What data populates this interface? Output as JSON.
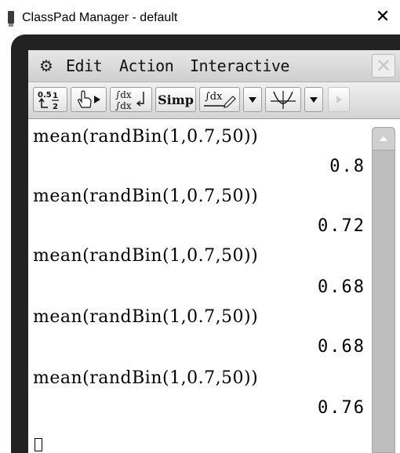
{
  "window": {
    "title": "ClassPad Manager - default",
    "close_symbol": "✕"
  },
  "menubar": {
    "gear_icon": "gear-icon",
    "items": [
      "Edit",
      "Action",
      "Interactive"
    ],
    "close_symbol": "✕"
  },
  "toolbar": {
    "buttons": [
      {
        "name": "decimal-fraction-toggle-icon"
      },
      {
        "name": "hand-drag-icon"
      },
      {
        "name": "integral-compare-icon"
      },
      {
        "name": "simp-button",
        "label": "Simp"
      },
      {
        "name": "integral-pen-icon"
      },
      {
        "name": "dropdown-arrow-icon"
      },
      {
        "name": "graph-icon"
      },
      {
        "name": "dropdown-arrow-icon"
      },
      {
        "name": "toolbar-scroll-right-icon"
      }
    ]
  },
  "work": {
    "entries": [
      {
        "input": "mean(randBin(1,0.7,50))",
        "output": "0.8"
      },
      {
        "input": "mean(randBin(1,0.7,50))",
        "output": "0.72"
      },
      {
        "input": "mean(randBin(1,0.7,50))",
        "output": "0.68"
      },
      {
        "input": "mean(randBin(1,0.7,50))",
        "output": "0.68"
      },
      {
        "input": "mean(randBin(1,0.7,50))",
        "output": "0.76"
      }
    ]
  },
  "colors": {
    "device_frame": "#222222",
    "scrollbar": "#bdbdbd"
  }
}
